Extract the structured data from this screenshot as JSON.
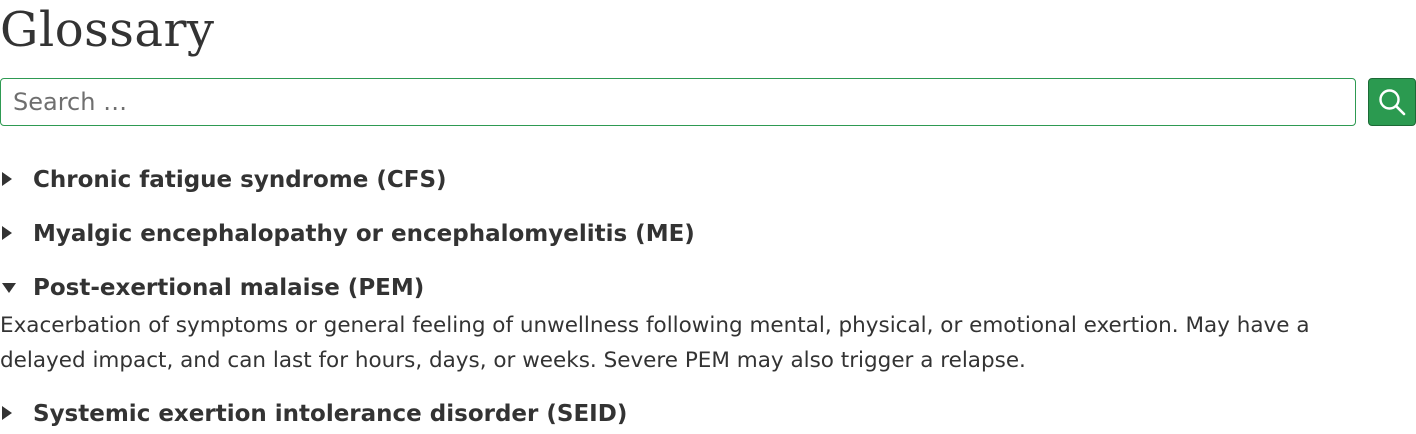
{
  "page": {
    "title": "Glossary"
  },
  "search": {
    "placeholder": "Search …",
    "value": "",
    "button_icon": "search-icon",
    "accent_color": "#2b9a50"
  },
  "glossary": {
    "terms": [
      {
        "title": "Chronic fatigue syndrome (CFS)",
        "expanded": false
      },
      {
        "title": "Myalgic encephalopathy or encephalomyelitis (ME)",
        "expanded": false
      },
      {
        "title": "Post-exertional malaise (PEM)",
        "expanded": true,
        "definition": "Exacerbation of symptoms or general feeling of unwellness following mental, physical, or emotional exertion. May have a delayed impact, and can last for hours, days, or weeks. Severe PEM may also trigger a relapse."
      },
      {
        "title": "Systemic exertion intolerance disorder (SEID)",
        "expanded": false
      }
    ]
  }
}
